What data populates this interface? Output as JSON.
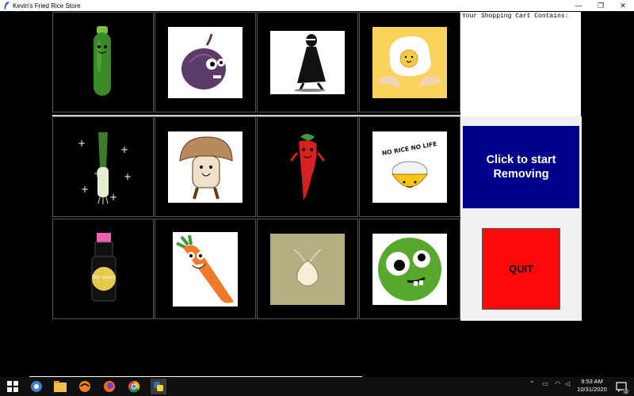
{
  "window": {
    "title": "Kevin's Fried Rice Store",
    "minimize": "—",
    "restore": "❐",
    "close": "✕"
  },
  "items": [
    {
      "name": "zucchini",
      "icon": "zucchini-icon"
    },
    {
      "name": "red-onion",
      "icon": "red-onion-icon"
    },
    {
      "name": "black-figure",
      "icon": "black-figure-icon"
    },
    {
      "name": "fried-egg",
      "icon": "fried-egg-icon"
    },
    {
      "name": "leek",
      "icon": "leek-icon"
    },
    {
      "name": "mushroom",
      "icon": "mushroom-icon"
    },
    {
      "name": "chili-pepper",
      "icon": "chili-pepper-icon"
    },
    {
      "name": "rice-bowl",
      "icon": "rice-bowl-icon",
      "text": "NO RICE NO LIFE"
    },
    {
      "name": "soy-sauce",
      "icon": "soy-sauce-icon",
      "text": "Soy sauce"
    },
    {
      "name": "carrot",
      "icon": "carrot-icon"
    },
    {
      "name": "garlic",
      "icon": "garlic-icon"
    },
    {
      "name": "green-pea",
      "icon": "green-pea-icon"
    }
  ],
  "cart": {
    "label": "Your Shopping Cart Contains:"
  },
  "buttons": {
    "remove_line1": "Click to start",
    "remove_line2": "Removing",
    "quit": "QUIT"
  },
  "colors": {
    "remove_bg": "#00008b",
    "quit_bg": "#ff0a0a"
  },
  "taskbar": {
    "time": "9:53 AM",
    "date": "10/31/2020",
    "notification_count": "2",
    "icons": [
      "windows-start-icon",
      "search-icon",
      "task-view-icon",
      "file-explorer-icon",
      "eclipse-icon",
      "firefox-icon",
      "chrome-icon",
      "python-icon"
    ]
  }
}
